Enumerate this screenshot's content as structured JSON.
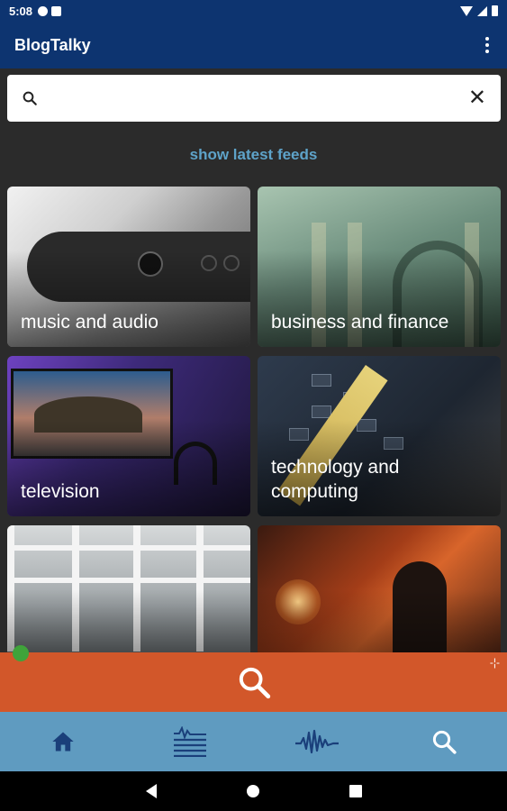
{
  "status_bar": {
    "time": "5:08",
    "icons": [
      "sync-icon",
      "sim-icon",
      "wifi-icon",
      "signal-icon",
      "battery-icon"
    ]
  },
  "app_bar": {
    "title": "BlogTalky",
    "menu_icon": "more-vert-icon"
  },
  "search": {
    "value": "",
    "placeholder": "",
    "search_icon": "search-icon",
    "clear_icon": "close-icon"
  },
  "latest_link": "show latest feeds",
  "categories": [
    {
      "label": "music and audio"
    },
    {
      "label": "business and finance"
    },
    {
      "label": "television"
    },
    {
      "label": "technology and\ncomputing"
    },
    {
      "label": ""
    },
    {
      "label": ""
    }
  ],
  "search_banner": {
    "icon": "search-icon"
  },
  "bottom_nav": {
    "items": [
      {
        "icon": "home-icon"
      },
      {
        "icon": "feed-list-icon"
      },
      {
        "icon": "audio-wave-icon"
      },
      {
        "icon": "search-icon"
      }
    ]
  },
  "colors": {
    "app_bar": "#0d3470",
    "background": "#2b2b2b",
    "link": "#5ea3c9",
    "banner": "#d2572a",
    "bottom_nav": "#5f9bc0",
    "nav_icon": "#1a3f7a"
  }
}
